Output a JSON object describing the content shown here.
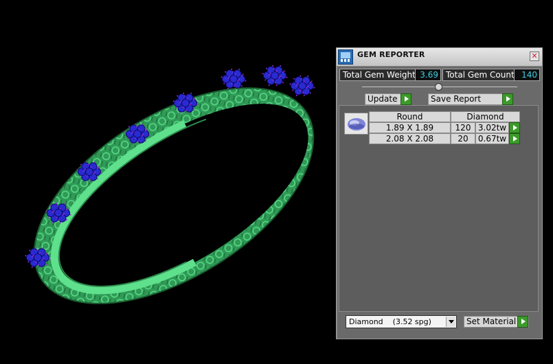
{
  "panel": {
    "title": "GEM REPORTER",
    "close_symbol": "✕",
    "total_weight_label": "Total Gem Weight",
    "total_weight_value": "3.69",
    "total_count_label": "Total Gem Count",
    "total_count_value": "140",
    "slider_level": 0.5,
    "update_label": "Update",
    "save_report_label": "Save Report",
    "table": {
      "shape": "Round",
      "material": "Diamond",
      "rows": [
        {
          "size": "1.89 X 1.89",
          "count": "120",
          "weight": "3.02tw"
        },
        {
          "size": "2.08 X 2.08",
          "count": "20",
          "weight": "0.67tw"
        }
      ]
    },
    "material_select_value": "Diamond    (3.52 spg)",
    "set_material_label": "Set Material"
  },
  "colors": {
    "metal": "#3cbf6a",
    "gem": "#2a2ad0",
    "prong": "#9a2ad6",
    "accent_value": "#3ad1e6",
    "go_button": "#3c9a2a"
  },
  "icons": {
    "app": "gem-reporter-icon",
    "close": "close-icon",
    "go": "play-arrow-icon",
    "gem_thumb": "round-gem-icon",
    "dropdown": "chevron-down-icon"
  }
}
